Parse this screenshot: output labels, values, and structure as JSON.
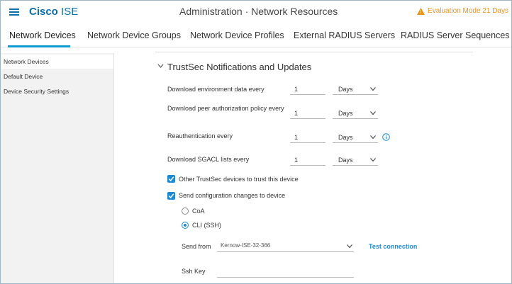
{
  "header": {
    "brand_bold": "Cisco",
    "brand_rest": "ISE",
    "title": "Administration · Network Resources",
    "evaluation": "Evaluation Mode 21 Days",
    "icons": [
      "hamburger-menu-icon",
      "warning-icon"
    ],
    "accent_color": "#0d6ea6",
    "warning_color": "#e8921d"
  },
  "tabs": [
    {
      "label": "Network Devices",
      "active": true
    },
    {
      "label": "Network Device Groups"
    },
    {
      "label": "Network Device Profiles"
    },
    {
      "label": "External RADIUS Servers"
    },
    {
      "label": "RADIUS Server Sequences"
    }
  ],
  "sidebar": {
    "items": [
      {
        "label": "Network Devices",
        "active": true
      },
      {
        "label": "Default Device"
      },
      {
        "label": "Device Security Settings"
      }
    ]
  },
  "section": {
    "title": "TrustSec Notifications and Updates",
    "rows": [
      {
        "label": "Download environment data every",
        "value": "1",
        "unit": "Days"
      },
      {
        "label": "Download peer authorization policy every",
        "value": "1",
        "unit": "Days"
      },
      {
        "label": "Reauthentication every",
        "value": "1",
        "unit": "Days"
      },
      {
        "label": "Download SGACL lists every",
        "value": "1",
        "unit": "Days"
      }
    ],
    "checkboxes": [
      {
        "label": "Other TrustSec devices to trust this device",
        "checked": true
      },
      {
        "label": "Send configuration changes to device",
        "checked": true
      }
    ],
    "radios": [
      {
        "label": "CoA",
        "selected": false
      },
      {
        "label": "CLI (SSH)",
        "selected": true
      }
    ],
    "send_from": {
      "label": "Send from",
      "value": "Kernow-ISE-32-366"
    },
    "test_connection": "Test connection",
    "ssh_key": {
      "label": "Ssh Key",
      "value": ""
    },
    "checkbox_color": "#1f8ad3"
  }
}
